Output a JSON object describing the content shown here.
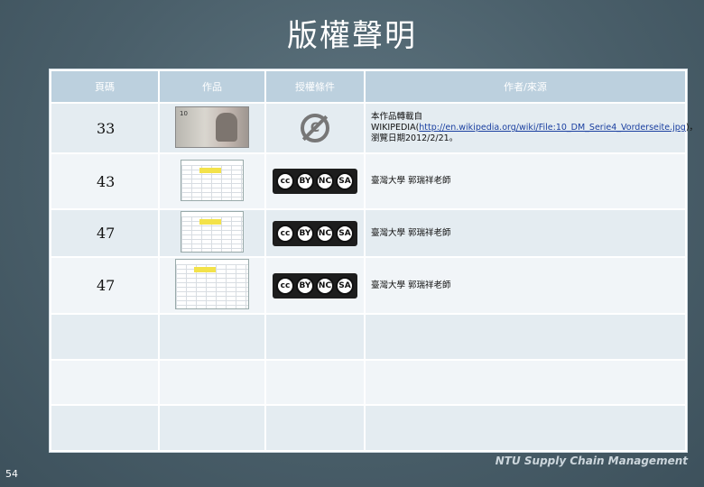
{
  "slide": {
    "title": "版權聲明",
    "number": "54",
    "brand": "NTU Supply Chain Management"
  },
  "table": {
    "headers": [
      "頁碼",
      "作品",
      "授權條件",
      "作者/來源"
    ],
    "rows": [
      {
        "page": "33",
        "image": "banknote-icon",
        "license": "public-domain-icon",
        "source_prefix": "本作品轉載自 WIKIPEDIA(",
        "source_link": "http://en.wikipedia.org/wiki/File:10_DM_Serie4_Vorderseite.jpg",
        "source_suffix": ")，瀏覽日期2012/2/21。"
      },
      {
        "page": "43",
        "image": "spreadsheet-icon",
        "license": "cc-by-nc-sa-icon",
        "source": "臺灣大學 郭瑞祥老師"
      },
      {
        "page": "47",
        "image": "spreadsheet-icon",
        "license": "cc-by-nc-sa-icon",
        "source": "臺灣大學 郭瑞祥老師"
      },
      {
        "page": "47",
        "image": "spreadsheet-icon",
        "license": "cc-by-nc-sa-icon",
        "source": "臺灣大學 郭瑞祥老師"
      }
    ],
    "cc_labels": {
      "cc": "cc",
      "by": "BY",
      "nc": "NC",
      "sa": "SA"
    },
    "pd_label": "C"
  },
  "colors": {
    "background": "#4a5f6a",
    "header": "#bcd0de",
    "row_odd": "#e4ecf1",
    "row_even": "#f1f5f8"
  }
}
